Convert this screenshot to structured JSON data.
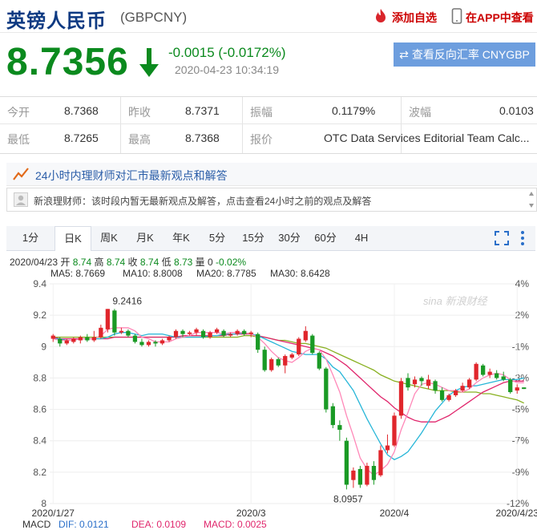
{
  "header": {
    "title": "英镑人民币",
    "code": "(GBPCNY)",
    "add_watchlist": "添加自选",
    "app_view": "在APP中查看"
  },
  "quote": {
    "price": "8.7356",
    "change": "-0.0015 (-0.0172%)",
    "time": "2020-04-23 10:34:19",
    "reverse_button": "查看反向汇率 CNYGBP"
  },
  "stats": {
    "open_label": "今开",
    "open_value": "8.7368",
    "prev_label": "昨收",
    "prev_value": "8.7371",
    "amp_label": "振幅",
    "amp_value": "0.1179%",
    "ask_label": "波幅",
    "ask_value": "0.0103",
    "low_label": "最低",
    "low_value": "8.7265",
    "high_label": "最高",
    "high_value": "8.7368",
    "quote_label": "报价",
    "quote_value": "OTC Data Services Editorial Team Calc..."
  },
  "qa": {
    "title": "24小时内理财师对汇市最新观点和解答",
    "message": "新浪理财师：该时段内暂无最新观点及解答，点击查看24小时之前的观点及解答"
  },
  "tabs": [
    "1分",
    "日K",
    "周K",
    "月K",
    "年K",
    "5分",
    "15分",
    "30分",
    "60分",
    "4H"
  ],
  "active_tab": "日K",
  "ohlc_info": {
    "date": "2020/04/23",
    "open_label": "开",
    "open": "8.74",
    "high_label": "高",
    "high": "8.74",
    "close_label": "收",
    "close": "8.74",
    "low_label": "低",
    "low": "8.73",
    "volume_label": "量",
    "volume": "0",
    "pct": "-0.02%"
  },
  "ma_legend": [
    {
      "text": "MA5: 8.7669",
      "color": "#ff88b8"
    },
    {
      "text": "MA10: 8.8008",
      "color": "#27b6d8"
    },
    {
      "text": "MA20: 8.7785",
      "color": "#e0266c"
    },
    {
      "text": "MA30: 8.6428",
      "color": "#88b020"
    }
  ],
  "macd": {
    "label": "MACD",
    "dif": "DIF: 0.0121",
    "dea": "DEA: 0.0109",
    "macd": "MACD: 0.0025"
  },
  "colors": {
    "up": "#e0262c",
    "down": "#1a9a25",
    "brand": "#0e3a82",
    "button": "#6d9ede"
  },
  "watermark": "新浪财经",
  "chart_data": {
    "type": "candlestick",
    "y_ticks": [
      "9.4",
      "9.2",
      "9",
      "8.8",
      "8.6",
      "8.4",
      "8.2",
      "8"
    ],
    "y_right_ticks": [
      "4%",
      "2%",
      "-1%",
      "-3%",
      "-5%",
      "-7%",
      "-9%",
      "-12%"
    ],
    "x_ticks": [
      "2020/1/27",
      "2020/3",
      "2020/4",
      "2020/4/23"
    ],
    "ylim": [
      8.0,
      9.4
    ],
    "high_annotation": "9.2416",
    "low_annotation": "8.0957",
    "candles": [
      {
        "o": 9.05,
        "c": 9.07,
        "h": 9.08,
        "l": 9.03
      },
      {
        "o": 9.05,
        "c": 9.02,
        "h": 9.06,
        "l": 9.0
      },
      {
        "o": 9.02,
        "c": 9.04,
        "h": 9.05,
        "l": 9.01
      },
      {
        "o": 9.03,
        "c": 9.05,
        "h": 9.06,
        "l": 9.02
      },
      {
        "o": 9.04,
        "c": 9.06,
        "h": 9.07,
        "l": 9.02
      },
      {
        "o": 9.06,
        "c": 9.04,
        "h": 9.08,
        "l": 9.03
      },
      {
        "o": 9.04,
        "c": 9.06,
        "h": 9.1,
        "l": 9.03
      },
      {
        "o": 9.06,
        "c": 9.12,
        "h": 9.14,
        "l": 9.05
      },
      {
        "o": 9.11,
        "c": 9.24,
        "h": 9.24,
        "l": 9.09
      },
      {
        "o": 9.23,
        "c": 9.09,
        "h": 9.24,
        "l": 9.07
      },
      {
        "o": 9.09,
        "c": 9.1,
        "h": 9.12,
        "l": 9.08
      },
      {
        "o": 9.1,
        "c": 9.07,
        "h": 9.11,
        "l": 9.06
      },
      {
        "o": 9.07,
        "c": 9.03,
        "h": 9.08,
        "l": 9.02
      },
      {
        "o": 9.03,
        "c": 9.01,
        "h": 9.05,
        "l": 9.0
      },
      {
        "o": 9.01,
        "c": 9.03,
        "h": 9.04,
        "l": 9.0
      },
      {
        "o": 9.03,
        "c": 9.02,
        "h": 9.04,
        "l": 9.0
      },
      {
        "o": 9.02,
        "c": 9.04,
        "h": 9.05,
        "l": 9.01
      },
      {
        "o": 9.04,
        "c": 9.06,
        "h": 9.07,
        "l": 9.03
      },
      {
        "o": 9.06,
        "c": 9.1,
        "h": 9.11,
        "l": 9.05
      },
      {
        "o": 9.1,
        "c": 9.08,
        "h": 9.11,
        "l": 9.06
      },
      {
        "o": 9.08,
        "c": 9.09,
        "h": 9.1,
        "l": 9.07
      },
      {
        "o": 9.09,
        "c": 9.11,
        "h": 9.12,
        "l": 9.07
      },
      {
        "o": 9.1,
        "c": 9.06,
        "h": 9.11,
        "l": 9.05
      },
      {
        "o": 9.06,
        "c": 9.09,
        "h": 9.1,
        "l": 9.05
      },
      {
        "o": 9.09,
        "c": 9.11,
        "h": 9.12,
        "l": 9.08
      },
      {
        "o": 9.1,
        "c": 9.07,
        "h": 9.11,
        "l": 9.06
      },
      {
        "o": 9.07,
        "c": 9.08,
        "h": 9.09,
        "l": 9.06
      },
      {
        "o": 9.08,
        "c": 9.1,
        "h": 9.11,
        "l": 9.07
      },
      {
        "o": 9.1,
        "c": 9.08,
        "h": 9.11,
        "l": 9.07
      },
      {
        "o": 9.08,
        "c": 9.09,
        "h": 9.1,
        "l": 9.06
      },
      {
        "o": 9.08,
        "c": 8.98,
        "h": 9.09,
        "l": 8.96
      },
      {
        "o": 8.98,
        "c": 8.85,
        "h": 9.0,
        "l": 8.84
      },
      {
        "o": 8.85,
        "c": 8.92,
        "h": 8.93,
        "l": 8.84
      },
      {
        "o": 8.92,
        "c": 8.88,
        "h": 8.93,
        "l": 8.87
      },
      {
        "o": 8.88,
        "c": 8.94,
        "h": 8.95,
        "l": 8.83
      },
      {
        "o": 8.93,
        "c": 8.95,
        "h": 8.96,
        "l": 8.92
      },
      {
        "o": 8.95,
        "c": 9.05,
        "h": 9.06,
        "l": 8.94
      },
      {
        "o": 9.04,
        "c": 9.1,
        "h": 9.13,
        "l": 9.03
      },
      {
        "o": 9.07,
        "c": 8.96,
        "h": 9.08,
        "l": 8.95
      },
      {
        "o": 8.96,
        "c": 8.86,
        "h": 8.97,
        "l": 8.85
      },
      {
        "o": 8.86,
        "c": 8.6,
        "h": 8.87,
        "l": 8.58
      },
      {
        "o": 8.62,
        "c": 8.5,
        "h": 8.64,
        "l": 8.48
      },
      {
        "o": 8.5,
        "c": 8.47,
        "h": 8.53,
        "l": 8.4
      },
      {
        "o": 8.4,
        "c": 8.12,
        "h": 8.42,
        "l": 8.09
      },
      {
        "o": 8.15,
        "c": 8.21,
        "h": 8.23,
        "l": 8.1
      },
      {
        "o": 8.22,
        "c": 8.12,
        "h": 8.24,
        "l": 8.1
      },
      {
        "o": 8.12,
        "c": 8.24,
        "h": 8.26,
        "l": 8.11
      },
      {
        "o": 8.24,
        "c": 8.15,
        "h": 8.27,
        "l": 8.12
      },
      {
        "o": 8.18,
        "c": 8.34,
        "h": 8.37,
        "l": 8.17
      },
      {
        "o": 8.34,
        "c": 8.37,
        "h": 8.44,
        "l": 8.32
      },
      {
        "o": 8.37,
        "c": 8.56,
        "h": 8.58,
        "l": 8.36
      },
      {
        "o": 8.56,
        "c": 8.78,
        "h": 8.8,
        "l": 8.54
      },
      {
        "o": 8.8,
        "c": 8.74,
        "h": 8.83,
        "l": 8.72
      },
      {
        "o": 8.76,
        "c": 8.79,
        "h": 8.81,
        "l": 8.74
      },
      {
        "o": 8.8,
        "c": 8.78,
        "h": 8.81,
        "l": 8.75
      },
      {
        "o": 8.75,
        "c": 8.79,
        "h": 8.82,
        "l": 8.73
      },
      {
        "o": 8.78,
        "c": 8.72,
        "h": 8.79,
        "l": 8.7
      },
      {
        "o": 8.72,
        "c": 8.66,
        "h": 8.74,
        "l": 8.65
      },
      {
        "o": 8.66,
        "c": 8.69,
        "h": 8.7,
        "l": 8.65
      },
      {
        "o": 8.69,
        "c": 8.72,
        "h": 8.73,
        "l": 8.68
      },
      {
        "o": 8.72,
        "c": 8.75,
        "h": 8.77,
        "l": 8.71
      },
      {
        "o": 8.74,
        "c": 8.79,
        "h": 8.8,
        "l": 8.73
      },
      {
        "o": 8.79,
        "c": 8.89,
        "h": 8.9,
        "l": 8.78
      },
      {
        "o": 8.88,
        "c": 8.82,
        "h": 8.89,
        "l": 8.81
      },
      {
        "o": 8.82,
        "c": 8.84,
        "h": 8.86,
        "l": 8.8
      },
      {
        "o": 8.83,
        "c": 8.8,
        "h": 8.85,
        "l": 8.79
      },
      {
        "o": 8.81,
        "c": 8.79,
        "h": 8.84,
        "l": 8.78
      },
      {
        "o": 8.79,
        "c": 8.71,
        "h": 8.8,
        "l": 8.7
      },
      {
        "o": 8.72,
        "c": 8.74,
        "h": 8.76,
        "l": 8.7
      },
      {
        "o": 8.74,
        "c": 8.73,
        "h": 8.74,
        "l": 8.73
      }
    ],
    "ma5": [
      9.05,
      9.04,
      9.04,
      9.04,
      9.05,
      9.05,
      9.05,
      9.07,
      9.11,
      9.12,
      9.12,
      9.12,
      9.1,
      9.06,
      9.05,
      9.03,
      9.03,
      9.03,
      9.05,
      9.06,
      9.07,
      9.09,
      9.09,
      9.09,
      9.09,
      9.08,
      9.09,
      9.09,
      9.09,
      9.08,
      9.06,
      9.02,
      8.97,
      8.93,
      8.91,
      8.9,
      8.93,
      8.97,
      8.99,
      8.98,
      8.92,
      8.82,
      8.71,
      8.56,
      8.43,
      8.29,
      8.22,
      8.18,
      8.21,
      8.25,
      8.33,
      8.47,
      8.58,
      8.7,
      8.76,
      8.77,
      8.76,
      8.74,
      8.72,
      8.72,
      8.71,
      8.73,
      8.77,
      8.8,
      8.82,
      8.83,
      8.82,
      8.79,
      8.77,
      8.77
    ],
    "ma10": [
      9.05,
      9.05,
      9.04,
      9.04,
      9.05,
      9.05,
      9.05,
      9.05,
      9.06,
      9.08,
      9.09,
      9.09,
      9.08,
      9.07,
      9.08,
      9.08,
      9.08,
      9.07,
      9.06,
      9.06,
      9.06,
      9.06,
      9.06,
      9.07,
      9.07,
      9.08,
      9.08,
      9.08,
      9.09,
      9.08,
      9.07,
      9.05,
      9.03,
      9.01,
      8.99,
      8.97,
      8.96,
      8.95,
      8.95,
      8.95,
      8.92,
      8.87,
      8.84,
      8.78,
      8.72,
      8.63,
      8.54,
      8.46,
      8.38,
      8.31,
      8.28,
      8.3,
      8.33,
      8.39,
      8.45,
      8.52,
      8.59,
      8.64,
      8.69,
      8.72,
      8.74,
      8.75,
      8.75,
      8.76,
      8.77,
      8.78,
      8.79,
      8.79,
      8.79,
      8.8
    ],
    "ma20": [
      9.06,
      9.05,
      9.05,
      9.05,
      9.05,
      9.05,
      9.05,
      9.05,
      9.05,
      9.06,
      9.06,
      9.06,
      9.06,
      9.06,
      9.06,
      9.06,
      9.06,
      9.06,
      9.06,
      9.07,
      9.07,
      9.07,
      9.07,
      9.07,
      9.07,
      9.07,
      9.08,
      9.08,
      9.08,
      9.08,
      9.07,
      9.06,
      9.05,
      9.04,
      9.03,
      9.02,
      9.01,
      9.0,
      8.99,
      8.98,
      8.96,
      8.94,
      8.91,
      8.88,
      8.84,
      8.8,
      8.76,
      8.72,
      8.68,
      8.65,
      8.61,
      8.58,
      8.55,
      8.53,
      8.52,
      8.52,
      8.52,
      8.54,
      8.56,
      8.59,
      8.62,
      8.65,
      8.68,
      8.71,
      8.73,
      8.75,
      8.77,
      8.78,
      8.78,
      8.78
    ],
    "ma30": [
      9.06,
      9.06,
      9.06,
      9.06,
      9.06,
      9.06,
      9.06,
      9.06,
      9.06,
      9.06,
      9.06,
      9.06,
      9.06,
      9.06,
      9.06,
      9.06,
      9.06,
      9.06,
      9.06,
      9.06,
      9.06,
      9.06,
      9.06,
      9.06,
      9.06,
      9.06,
      9.06,
      9.06,
      9.07,
      9.07,
      9.06,
      9.06,
      9.05,
      9.04,
      9.04,
      9.03,
      9.02,
      9.02,
      9.01,
      9.0,
      8.99,
      8.97,
      8.95,
      8.93,
      8.91,
      8.89,
      8.87,
      8.85,
      8.82,
      8.8,
      8.78,
      8.77,
      8.76,
      8.75,
      8.74,
      8.73,
      8.72,
      8.72,
      8.72,
      8.71,
      8.71,
      8.71,
      8.71,
      8.7,
      8.7,
      8.69,
      8.68,
      8.67,
      8.66,
      8.64
    ]
  }
}
